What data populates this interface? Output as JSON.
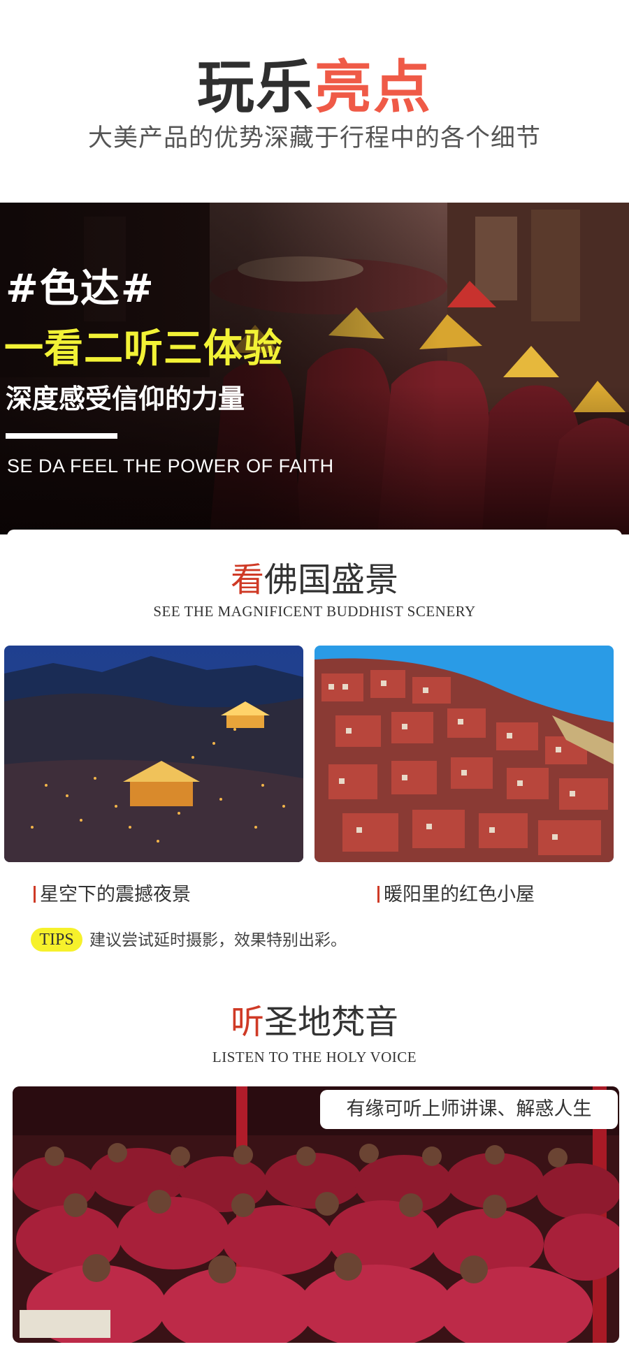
{
  "header": {
    "title_plain": "玩乐",
    "title_accent": "亮点",
    "subtitle": "大美产品的优势深藏于行程中的各个细节"
  },
  "hero": {
    "tag": "#色达#",
    "headline": "一看二听三体验",
    "subtitle": "深度感受信仰的力量",
    "english": "SE DA  FEEL THE POWER OF FAITH"
  },
  "scenery": {
    "title_accent": "看",
    "title_rest": "佛国盛景",
    "english": "SEE THE MAGNIFICENT BUDDHIST SCENERY",
    "photos": [
      {
        "caption": "星空下的震撼夜景"
      },
      {
        "caption": "暖阳里的红色小屋"
      }
    ],
    "tips_label": "TIPS",
    "tips_text": "建议尝试延时摄影，效果特别出彩。"
  },
  "voice": {
    "title_accent": "听",
    "title_rest": "圣地梵音",
    "english": "LISTEN TO THE HOLY VOICE",
    "bubble": "有缘可听上师讲课、解惑人生"
  },
  "colors": {
    "accent_red": "#ef5a47",
    "title_red": "#cf3a26",
    "headline_yellow": "#f2f236",
    "tips_yellow": "#f6f12b"
  }
}
